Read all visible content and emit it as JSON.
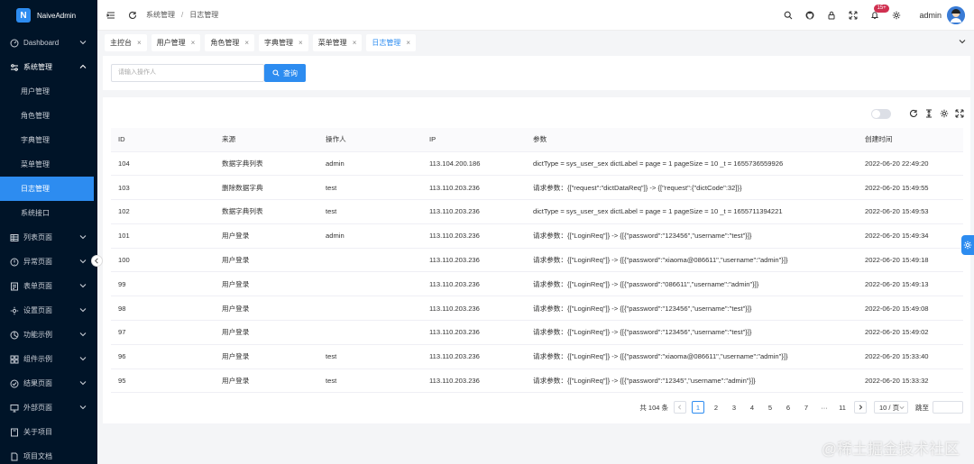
{
  "app": {
    "name": "NaiveAdmin"
  },
  "sidebar": {
    "items": [
      {
        "label": "Dashboard",
        "icon": "dashboard-icon"
      },
      {
        "label": "系统管理",
        "icon": "system-settings-icon",
        "open": true,
        "children": [
          "用户管理",
          "角色管理",
          "字典管理",
          "菜单管理",
          "日志管理",
          "系统接口"
        ]
      },
      {
        "label": "列表页面",
        "icon": "table-icon"
      },
      {
        "label": "异常页面",
        "icon": "exception-icon"
      },
      {
        "label": "表单页面",
        "icon": "form-icon"
      },
      {
        "label": "设置页面",
        "icon": "settings-icon"
      },
      {
        "label": "功能示例",
        "icon": "feature-icon"
      },
      {
        "label": "组件示例",
        "icon": "component-icon"
      },
      {
        "label": "结果页面",
        "icon": "result-icon"
      },
      {
        "label": "外部页面",
        "icon": "external-icon"
      },
      {
        "label": "关于项目",
        "icon": "about-icon"
      },
      {
        "label": "项目文档",
        "icon": "docs-icon"
      }
    ],
    "active_child": "日志管理"
  },
  "header": {
    "breadcrumb": [
      "系统管理",
      "日志管理"
    ],
    "notification_badge": "15+",
    "username": "admin"
  },
  "tabs": [
    {
      "label": "主控台"
    },
    {
      "label": "用户管理"
    },
    {
      "label": "角色管理"
    },
    {
      "label": "字典管理"
    },
    {
      "label": "菜单管理"
    },
    {
      "label": "日志管理",
      "active": true
    }
  ],
  "search": {
    "placeholder": "请输入操作人",
    "button_label": "查询"
  },
  "table": {
    "columns": [
      "ID",
      "来源",
      "操作人",
      "IP",
      "参数",
      "创建时间"
    ],
    "rows": [
      [
        "104",
        "数据字典列表",
        "admin",
        "113.104.200.186",
        "dictType = sys_user_sex dictLabel = page = 1 pageSize = 10 _t = 1655736559926",
        "2022-06-20 22:49:20"
      ],
      [
        "103",
        "删除数据字典",
        "test",
        "113.110.203.236",
        "请求参数：{[\"request\":\"dictDataReq\"]} -> {[\"request\":{\"dictCode\":32]}}",
        "2022-06-20 15:49:55"
      ],
      [
        "102",
        "数据字典列表",
        "test",
        "113.110.203.236",
        "dictType = sys_user_sex dictLabel = page = 1 pageSize = 10 _t = 1655711394221",
        "2022-06-20 15:49:53"
      ],
      [
        "101",
        "用户登录",
        "admin",
        "113.110.203.236",
        "请求参数：{[\"LoginReq\"]} -> {[{\"password\":\"123456\",\"username\":\"test\"}]}",
        "2022-06-20 15:49:34"
      ],
      [
        "100",
        "用户登录",
        "",
        "113.110.203.236",
        "请求参数：{[\"LoginReq\"]} -> {[{\"password\":\"xiaoma@086611\",\"username\":\"admin\"}]}",
        "2022-06-20 15:49:18"
      ],
      [
        "99",
        "用户登录",
        "",
        "113.110.203.236",
        "请求参数：{[\"LoginReq\"]} -> {[{\"password\":\"086611\",\"username\":\"admin\"}]}",
        "2022-06-20 15:49:13"
      ],
      [
        "98",
        "用户登录",
        "",
        "113.110.203.236",
        "请求参数：{[\"LoginReq\"]} -> {[{\"password\":\"123456\",\"username\":\"test\"}]}",
        "2022-06-20 15:49:08"
      ],
      [
        "97",
        "用户登录",
        "",
        "113.110.203.236",
        "请求参数：{[\"LoginReq\"]} -> {[{\"password\":\"123456\",\"username\":\"test\"}]}",
        "2022-06-20 15:49:02"
      ],
      [
        "96",
        "用户登录",
        "test",
        "113.110.203.236",
        "请求参数：{[\"LoginReq\"]} -> {[{\"password\":\"xiaoma@086611\",\"username\":\"admin\"}]}",
        "2022-06-20 15:33:40"
      ],
      [
        "95",
        "用户登录",
        "test",
        "113.110.203.236",
        "请求参数：{[\"LoginReq\"]} -> {[{\"password\":\"12345\",\"username\":\"admin\"}]}",
        "2022-06-20 15:33:32"
      ]
    ]
  },
  "pagination": {
    "total_label": "共 104 条",
    "pages": [
      "1",
      "2",
      "3",
      "4",
      "5",
      "6",
      "7",
      "···",
      "11"
    ],
    "current": "1",
    "page_size": "10 / 页",
    "jump_label": "跳至"
  },
  "watermark": "@稀土掘金技术社区",
  "colors": {
    "primary": "#2d8cf0",
    "sidebar_bg": "#001428",
    "badge": "#d03050"
  }
}
